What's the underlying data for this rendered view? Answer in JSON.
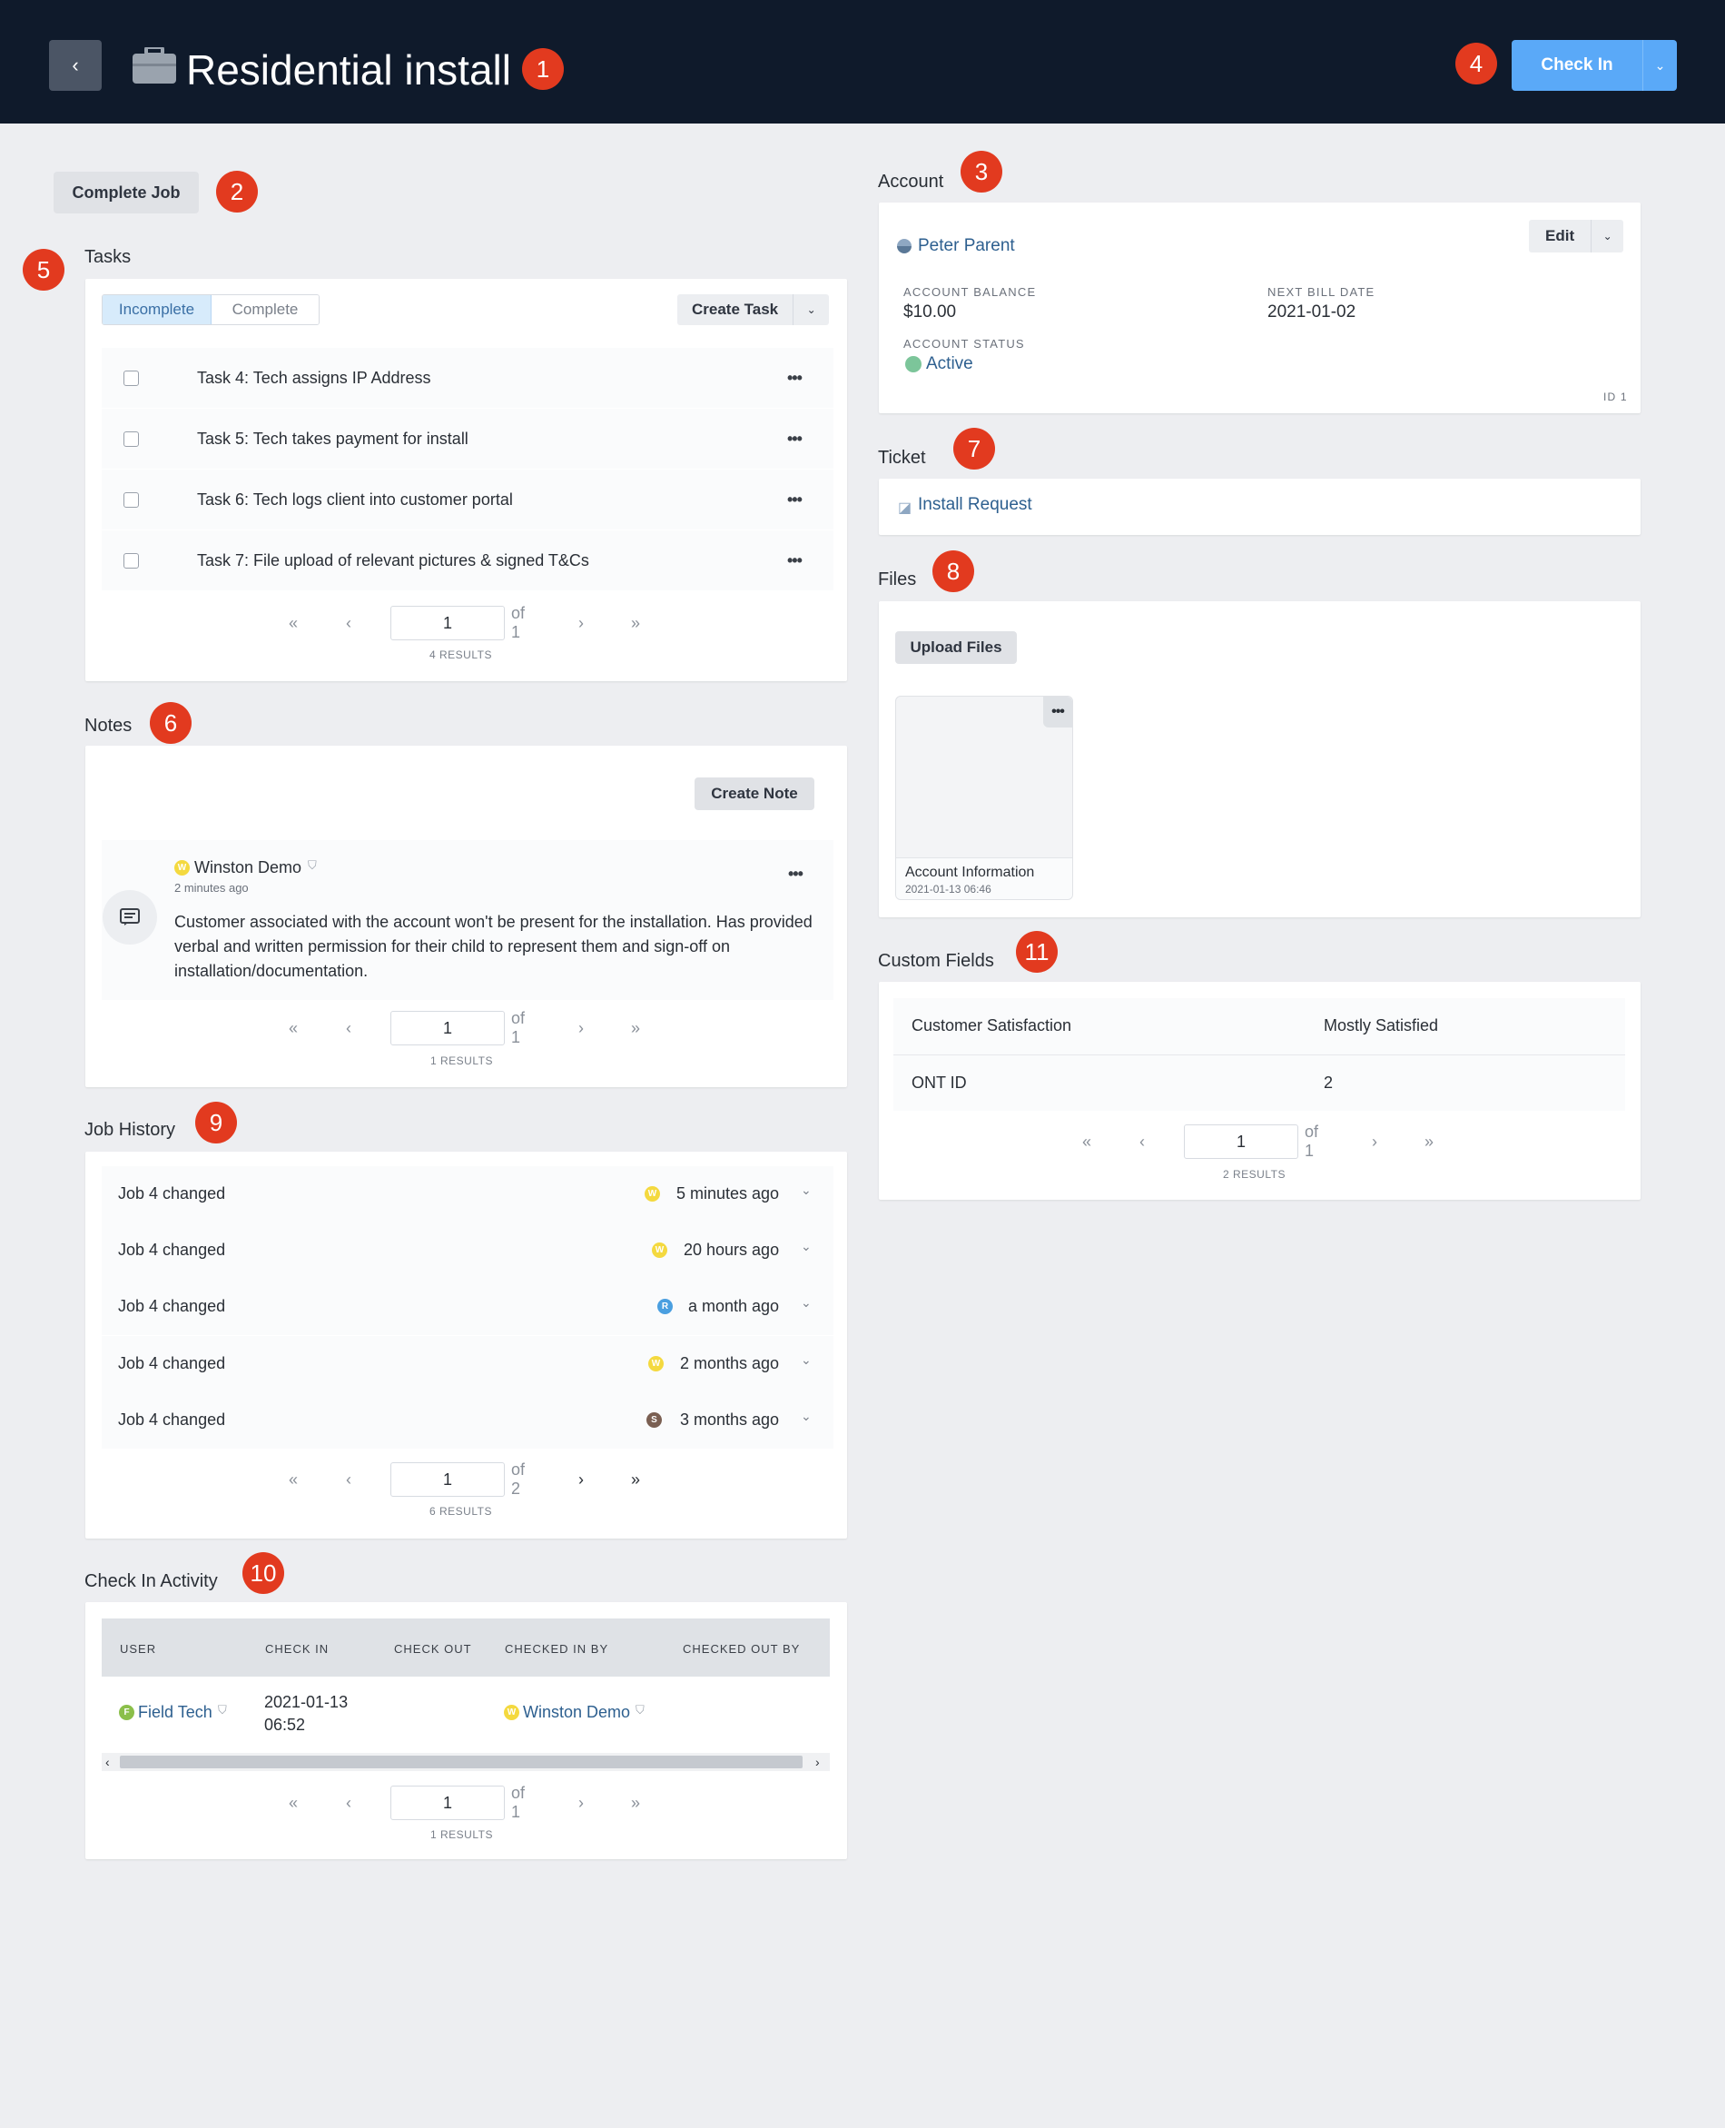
{
  "header": {
    "title": "Residential install",
    "back_label": "‹",
    "checkin_label": "Check In"
  },
  "markers": [
    "1",
    "2",
    "3",
    "4",
    "5",
    "6",
    "7",
    "8",
    "9",
    "10",
    "11"
  ],
  "complete_job_label": "Complete Job",
  "tasks": {
    "label": "Tasks",
    "tab_incomplete": "Incomplete",
    "tab_complete": "Complete",
    "create_label": "Create Task",
    "items": [
      "Task 4: Tech assigns IP Address",
      "Task 5: Tech takes payment for install",
      "Task 6: Tech logs client into customer portal",
      "Task 7: File upload of relevant pictures & signed T&Cs"
    ],
    "page": "1",
    "of": "of 1",
    "results": "4 RESULTS"
  },
  "notes": {
    "label": "Notes",
    "create_label": "Create Note",
    "author": "Winston Demo",
    "author_initial": "W",
    "time": "2 minutes ago",
    "body": "Customer associated with the account won't be present for the installation. Has provided verbal and written permission for their child to represent them and sign-off on installation/documentation.",
    "page": "1",
    "of": "of 1",
    "results": "1 RESULTS"
  },
  "job_history": {
    "label": "Job History",
    "rows": [
      {
        "text": "Job 4 changed",
        "initial": "W",
        "when": "5 minutes ago",
        "color": "#f4d93f"
      },
      {
        "text": "Job 4 changed",
        "initial": "W",
        "when": "20 hours ago",
        "color": "#f4d93f"
      },
      {
        "text": "Job 4 changed",
        "initial": "R",
        "when": "a month ago",
        "color": "#4a9fe0"
      },
      {
        "text": "Job 4 changed",
        "initial": "W",
        "when": "2 months ago",
        "color": "#f4d93f"
      },
      {
        "text": "Job 4 changed",
        "initial": "S",
        "when": "3 months ago",
        "color": "#7a5f52"
      }
    ],
    "page": "1",
    "of": "of 2",
    "results": "6 RESULTS"
  },
  "checkin": {
    "label": "Check In Activity",
    "columns": [
      "USER",
      "CHECK IN",
      "CHECK OUT",
      "CHECKED IN BY",
      "CHECKED OUT BY"
    ],
    "row": {
      "user": "Field Tech",
      "user_initial": "F",
      "check_in_date": "2021-01-13",
      "check_in_time": "06:52",
      "checked_in_by": "Winston Demo",
      "checked_in_by_initial": "W"
    },
    "page": "1",
    "of": "of 1",
    "results": "1 RESULTS"
  },
  "account": {
    "label": "Account",
    "name": "Peter Parent",
    "edit_label": "Edit",
    "balance_label": "ACCOUNT BALANCE",
    "balance": "$10.00",
    "bill_label": "NEXT BILL DATE",
    "bill_date": "2021-01-02",
    "status_label": "ACCOUNT STATUS",
    "status": "Active",
    "id": "ID 1"
  },
  "ticket": {
    "label": "Ticket",
    "name": "Install Request"
  },
  "files": {
    "label": "Files",
    "upload_label": "Upload Files",
    "file_name": "Account Information",
    "file_date": "2021-01-13 06:46"
  },
  "custom_fields": {
    "label": "Custom Fields",
    "rows": [
      {
        "key": "Customer Satisfaction",
        "value": "Mostly Satisfied"
      },
      {
        "key": "ONT ID",
        "value": "2"
      }
    ],
    "page": "1",
    "of": "of 1",
    "results": "2 RESULTS"
  },
  "pager_glyphs": {
    "first": "«",
    "prev": "‹",
    "next": "›",
    "last": "»"
  },
  "menu_glyph": "•••",
  "colors": {
    "header_bg": "#0f1a2b",
    "primary": "#5aa9f8",
    "marker": "#e23a1f",
    "link": "#2d5f8f",
    "active": "#7cc59a"
  }
}
